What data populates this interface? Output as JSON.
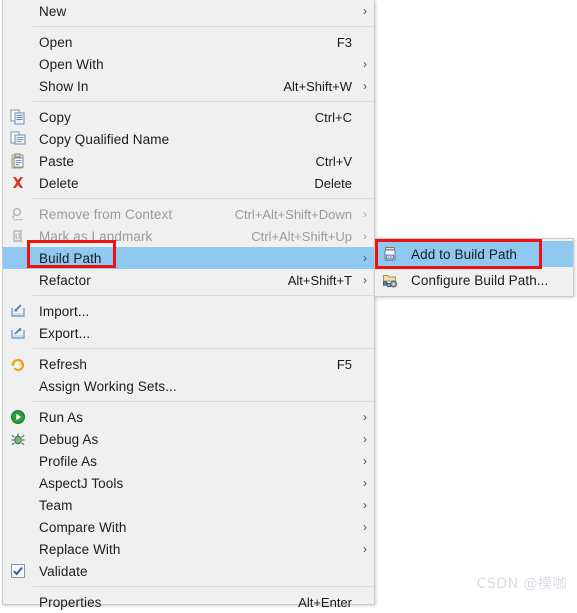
{
  "menu": {
    "groups": [
      {
        "items": [
          {
            "label": "New",
            "accel": "",
            "arrow": true,
            "icon": "",
            "disabled": false,
            "highlight": false
          }
        ]
      },
      {
        "items": [
          {
            "label": "Open",
            "accel": "F3",
            "arrow": false,
            "icon": "",
            "disabled": false,
            "highlight": false
          },
          {
            "label": "Open With",
            "accel": "",
            "arrow": true,
            "icon": "",
            "disabled": false,
            "highlight": false
          },
          {
            "label": "Show In",
            "accel": "Alt+Shift+W",
            "arrow": true,
            "icon": "",
            "disabled": false,
            "highlight": false
          }
        ]
      },
      {
        "items": [
          {
            "label": "Copy",
            "accel": "Ctrl+C",
            "arrow": false,
            "icon": "copy-icon",
            "disabled": false,
            "highlight": false
          },
          {
            "label": "Copy Qualified Name",
            "accel": "",
            "arrow": false,
            "icon": "copy-qualified-name-icon",
            "disabled": false,
            "highlight": false
          },
          {
            "label": "Paste",
            "accel": "Ctrl+V",
            "arrow": false,
            "icon": "paste-icon",
            "disabled": false,
            "highlight": false
          },
          {
            "label": "Delete",
            "accel": "Delete",
            "arrow": false,
            "icon": "delete-icon",
            "disabled": false,
            "highlight": false
          }
        ]
      },
      {
        "items": [
          {
            "label": "Remove from Context",
            "accel": "Ctrl+Alt+Shift+Down",
            "arrow": false,
            "icon": "remove-from-context-icon",
            "disabled": true,
            "highlight": false
          },
          {
            "label": "Mark as Landmark",
            "accel": "Ctrl+Alt+Shift+Up",
            "arrow": false,
            "icon": "mark-as-landmark-icon",
            "disabled": true,
            "highlight": false
          },
          {
            "label": "Build Path",
            "accel": "",
            "arrow": true,
            "icon": "",
            "disabled": false,
            "highlight": true
          },
          {
            "label": "Refactor",
            "accel": "Alt+Shift+T",
            "arrow": true,
            "icon": "",
            "disabled": false,
            "highlight": false
          }
        ]
      },
      {
        "items": [
          {
            "label": "Import...",
            "accel": "",
            "arrow": false,
            "icon": "import-icon",
            "disabled": false,
            "highlight": false
          },
          {
            "label": "Export...",
            "accel": "",
            "arrow": false,
            "icon": "export-icon",
            "disabled": false,
            "highlight": false
          }
        ]
      },
      {
        "items": [
          {
            "label": "Refresh",
            "accel": "F5",
            "arrow": false,
            "icon": "refresh-icon",
            "disabled": false,
            "highlight": false
          },
          {
            "label": "Assign Working Sets...",
            "accel": "",
            "arrow": false,
            "icon": "",
            "disabled": false,
            "highlight": false
          }
        ]
      },
      {
        "items": [
          {
            "label": "Run As",
            "accel": "",
            "arrow": true,
            "icon": "run-as-icon",
            "disabled": false,
            "highlight": false
          },
          {
            "label": "Debug As",
            "accel": "",
            "arrow": true,
            "icon": "debug-as-icon",
            "disabled": false,
            "highlight": false
          },
          {
            "label": "Profile As",
            "accel": "",
            "arrow": true,
            "icon": "",
            "disabled": false,
            "highlight": false
          },
          {
            "label": "AspectJ Tools",
            "accel": "",
            "arrow": true,
            "icon": "",
            "disabled": false,
            "highlight": false
          },
          {
            "label": "Team",
            "accel": "",
            "arrow": true,
            "icon": "",
            "disabled": false,
            "highlight": false
          },
          {
            "label": "Compare With",
            "accel": "",
            "arrow": true,
            "icon": "",
            "disabled": false,
            "highlight": false
          },
          {
            "label": "Replace With",
            "accel": "",
            "arrow": true,
            "icon": "",
            "disabled": false,
            "highlight": false
          },
          {
            "label": "Validate",
            "accel": "",
            "arrow": false,
            "icon": "validate-checkbox-icon",
            "disabled": false,
            "highlight": false
          }
        ]
      },
      {
        "items": [
          {
            "label": "Properties",
            "accel": "Alt+Enter",
            "arrow": false,
            "icon": "",
            "disabled": false,
            "highlight": false
          }
        ]
      }
    ]
  },
  "submenu": {
    "items": [
      {
        "label": "Add to Build Path",
        "accel": "",
        "arrow": false,
        "icon": "jar-icon",
        "disabled": false,
        "highlight": true
      },
      {
        "label": "Configure Build Path...",
        "accel": "",
        "arrow": false,
        "icon": "configure-build-path-icon",
        "disabled": false,
        "highlight": false
      }
    ]
  },
  "annotations": {
    "box_color": "#ee1111",
    "highlight_color": "#8fc9f2"
  },
  "watermark": {
    "text": "CSDN @摸咖"
  }
}
